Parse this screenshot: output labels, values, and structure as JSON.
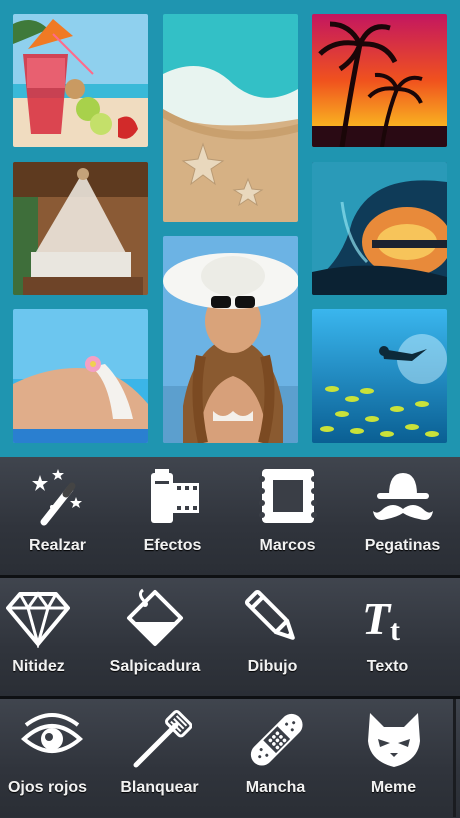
{
  "collage": {
    "photos": [
      {
        "name": "cocktail-photo",
        "colors": [
          "#8fd0ee",
          "#f4e1c2"
        ]
      },
      {
        "name": "beach-starfish-photo",
        "colors": [
          "#35c3c9",
          "#d9b78a"
        ]
      },
      {
        "name": "palm-sunset-photo",
        "colors": [
          "#d0245a",
          "#f7a316"
        ]
      },
      {
        "name": "canopy-bed-photo",
        "colors": [
          "#7a4a2a",
          "#e9e4da"
        ]
      },
      {
        "name": "woman-hat-photo",
        "colors": [
          "#6fb4e3",
          "#c08a60"
        ]
      },
      {
        "name": "wave-sunset-photo",
        "colors": [
          "#1c5a7a",
          "#f3a83a"
        ]
      },
      {
        "name": "beach-body-photo",
        "colors": [
          "#5bc3ef",
          "#e2b08e"
        ]
      },
      {
        "name": "diver-fish-photo",
        "colors": [
          "#2aa5dd",
          "#0d6a9b"
        ]
      }
    ]
  },
  "tools": [
    {
      "id": "realzar",
      "label": "Realzar",
      "icon": "magic-wand-icon"
    },
    {
      "id": "efectos",
      "label": "Efectos",
      "icon": "film-roll-icon"
    },
    {
      "id": "marcos",
      "label": "Marcos",
      "icon": "frame-icon"
    },
    {
      "id": "pegatinas",
      "label": "Pegatinas",
      "icon": "hat-mustache-icon"
    },
    {
      "id": "nitidez",
      "label": "Nitidez",
      "icon": "diamond-icon"
    },
    {
      "id": "salpicadura",
      "label": "Salpicadura",
      "icon": "paint-bucket-icon"
    },
    {
      "id": "dibujo",
      "label": "Dibujo",
      "icon": "pencil-icon"
    },
    {
      "id": "texto",
      "label": "Texto",
      "icon": "text-tt-icon"
    },
    {
      "id": "ojos-rojos",
      "label": "Ojos rojos",
      "icon": "eye-icon"
    },
    {
      "id": "blanquear",
      "label": "Blanquear",
      "icon": "toothbrush-icon"
    },
    {
      "id": "mancha",
      "label": "Mancha",
      "icon": "bandage-icon"
    },
    {
      "id": "meme",
      "label": "Meme",
      "icon": "cat-face-icon"
    }
  ]
}
